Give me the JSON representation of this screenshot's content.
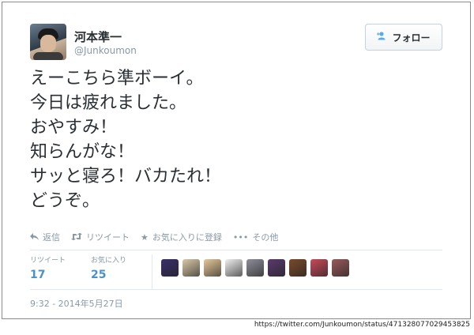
{
  "user": {
    "name": "河本準一",
    "handle": "@Junkoumon"
  },
  "follow_button": {
    "label": "フォロー",
    "icon": "follow-person-icon"
  },
  "tweet": {
    "lines": [
      "えーこちら準ボーイ。",
      "今日は疲れました。",
      "おやすみ！",
      "知らんがな！",
      "サッと寝ろ！バカたれ！",
      "どうぞ。"
    ]
  },
  "actions": {
    "reply": {
      "label": "返信",
      "icon": "reply-icon"
    },
    "retweet": {
      "label": "リツイート",
      "icon": "retweet-icon"
    },
    "favorite": {
      "label": "お気に入りに登録",
      "icon": "star-icon"
    },
    "more": {
      "label": "その他",
      "icon": "more-icon"
    }
  },
  "stats": {
    "retweets_label": "リツイート",
    "retweets": "17",
    "favorites_label": "お気に入り",
    "favorites": "25"
  },
  "favoriters": [
    {
      "color": "#3a2f6b"
    },
    {
      "color": "#d9c9a8"
    },
    {
      "color": "#e6c89a"
    },
    {
      "color": "#f0f0f0"
    },
    {
      "color": "#8e8e9a"
    },
    {
      "color": "#5a3a6e"
    },
    {
      "color": "#7a4a2a"
    },
    {
      "color": "#c94a5a"
    },
    {
      "color": "#9a5a5a"
    }
  ],
  "timestamp": "9:32 - 2014年5月27日",
  "source_url": "https://twitter.com/Junkoumon/status/471328077029453825",
  "colors": {
    "accent": "#55acee",
    "stat_number": "#4a91c7",
    "muted": "#8899a6"
  }
}
